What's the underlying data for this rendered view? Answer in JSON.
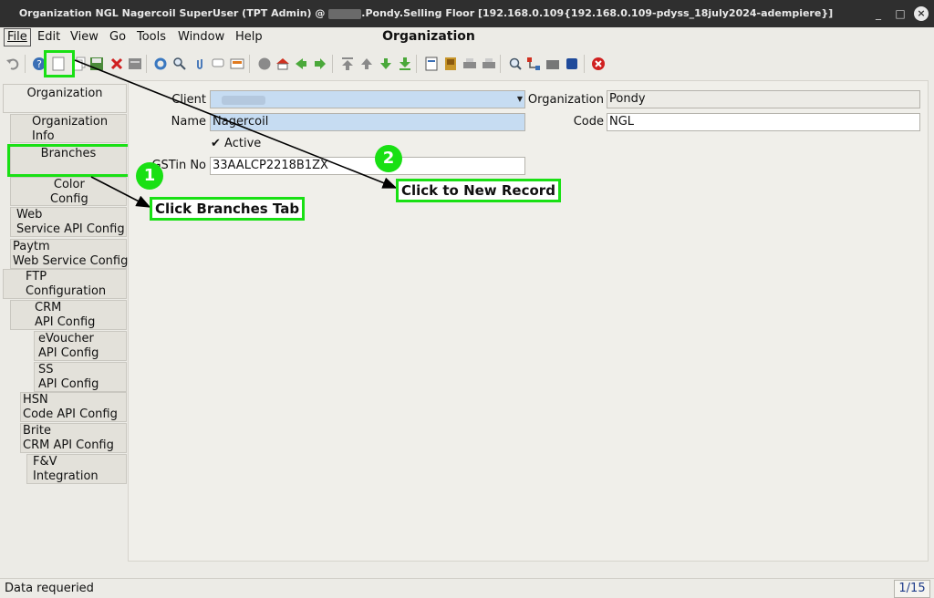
{
  "window": {
    "title_prefix": "Organization  NGL  Nagercoil  SuperUser (TPT Admin) @",
    "title_suffix": ".Pondy.Selling Floor [192.168.0.109{192.168.0.109-pdyss_18july2024-adempiere}]",
    "minimize": "_",
    "maximize": "□",
    "close": "×"
  },
  "menu": {
    "file": "File",
    "edit": "Edit",
    "view": "View",
    "go": "Go",
    "tools": "Tools",
    "window": "Window",
    "help": "Help"
  },
  "heading": "Organization",
  "toolbar": {
    "icons": [
      "undo-icon",
      "help-icon",
      "new-record-icon",
      "copy-record-icon",
      "save-icon",
      "delete-icon",
      "grid-toggle-icon",
      "refresh-icon",
      "find-icon",
      "attachment-icon",
      "chat-icon",
      "history-icon",
      "archive-icon",
      "home-icon",
      "previous-arrow-icon",
      "next-arrow-icon",
      "first-record-icon",
      "previous-record-icon",
      "next-record-icon",
      "last-record-icon",
      "report-icon",
      "archived-docs-icon",
      "print-preview-icon",
      "print-icon",
      "zoom-across-icon",
      "workflow-icon",
      "request-icon",
      "product-info-icon",
      "exit-icon"
    ]
  },
  "tabs": [
    {
      "id": "organization",
      "label": "Organization"
    },
    {
      "id": "organization-info",
      "label": "Organization\nInfo"
    },
    {
      "id": "branches",
      "label": "Branches"
    },
    {
      "id": "color-config",
      "label": "Color\nConfig"
    },
    {
      "id": "web-service-api-config",
      "label": "Web\nService API Config"
    },
    {
      "id": "paytm-web-service-config",
      "label": "Paytm\nWeb Service Config"
    },
    {
      "id": "ftp-configuration",
      "label": "FTP\nConfiguration"
    },
    {
      "id": "crm-api-config",
      "label": "CRM\nAPI Config"
    },
    {
      "id": "evoucher-api-config",
      "label": "eVoucher\nAPI Config"
    },
    {
      "id": "ss-api-config",
      "label": "SS\nAPI Config"
    },
    {
      "id": "hsn-code-api-config",
      "label": "HSN\nCode API Config"
    },
    {
      "id": "brite-crm-api-config",
      "label": "Brite\nCRM API Config"
    },
    {
      "id": "fv-integration",
      "label": "F&V\nIntegration"
    }
  ],
  "form": {
    "client_label": "Client",
    "client_value": "",
    "name_label": "Name",
    "name_value": "Nagercoil",
    "active_label": "Active",
    "active_checked": true,
    "gstin_label": "GSTin No",
    "gstin_value": "33AALCP2218B1ZX",
    "organization_label": "Organization",
    "organization_value": "Pondy",
    "code_label": "Code",
    "code_value": "NGL"
  },
  "annotations": {
    "step1_number": "1",
    "step1_text": "Click Branches Tab",
    "step2_number": "2",
    "step2_text": "Click to New Record",
    "highlight_color": "#19e014"
  },
  "status": {
    "message": "Data requeried",
    "record_count": "1/15"
  }
}
